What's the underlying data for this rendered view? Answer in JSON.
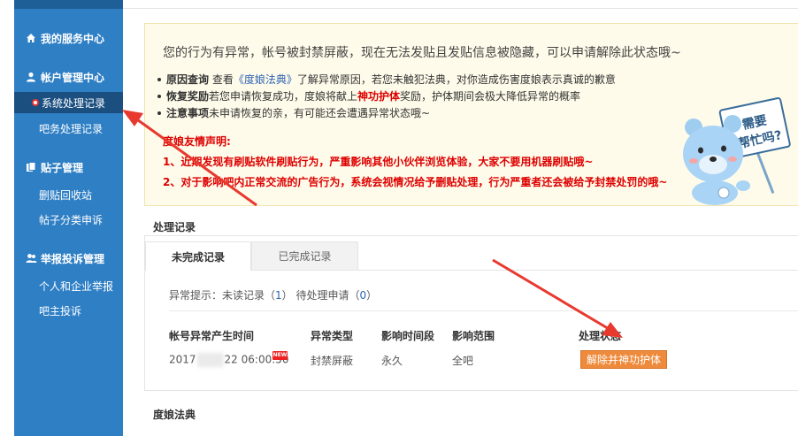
{
  "sidebar": {
    "sections": [
      {
        "label": "我的服务中心",
        "icon": "home-icon",
        "items": []
      },
      {
        "label": "帐户管理中心",
        "icon": "user-icon",
        "items": [
          "系统处理记录",
          "吧务处理记录"
        ]
      },
      {
        "label": "贴子管理",
        "icon": "document-icon",
        "items": [
          "删贴回收站",
          "帖子分类申诉"
        ]
      },
      {
        "label": "举报投诉管理",
        "icon": "users-icon",
        "items": [
          "个人和企业举报",
          "吧主投诉"
        ]
      }
    ]
  },
  "notice": {
    "title": "您的行为有异常，帐号被封禁屏蔽，现在无法发贴且发贴信息被隐藏，可以申请解除此状态哦~",
    "items": [
      {
        "key": "原因查询",
        "pre": " 查看",
        "link": "《度娘法典》",
        "post": "了解异常原因，若您未触犯法典，对你造成伤害度娘表示真诚的歉意"
      },
      {
        "key": "恢复奖励",
        "pre": "若您申请恢复成功，度娘将献上",
        "red": "神功护体",
        "post": "奖励，护体期间会极大降低异常的概率"
      },
      {
        "key": "注意事项",
        "pre": "未申请恢复的亲，有可能还会遭遇异常状态哦~"
      }
    ],
    "declaration_title": "度娘友情声明:",
    "declarations": [
      "1、近期发现有刷贴软件刷贴行为，严重影响其他小伙伴浏览体验，大家不要用机器刷贴哦~",
      "2、对于影响吧内正常交流的广告行为，系统会视情况给予删贴处理，行为严重者还会被给予封禁处罚的哦~"
    ],
    "mascot_sign": "需要\n帮忙吗?"
  },
  "records": {
    "section_title": "处理记录",
    "tabs": [
      "未完成记录",
      "已完成记录"
    ],
    "hint_prefix": "异常提示：未读记录（",
    "unread": "1",
    "hint_mid": "）  待处理申请（",
    "pending": "0",
    "hint_suffix": "）",
    "columns": [
      "帐号异常产生时间",
      "异常类型",
      "影响时间段",
      "影响范围",
      "处理状态"
    ],
    "row": {
      "time_a": "2017",
      "time_b": "22 06:00:50",
      "new_badge": "NEW",
      "type": "封禁屏蔽",
      "duration": "永久",
      "scope": "全吧",
      "action": "解除并神功护体"
    }
  },
  "law_title": "度娘法典",
  "colors": {
    "sidebar": "#2f7fc5",
    "sidebar_active": "#1b4f80",
    "notice_bg": "#fffbea",
    "red_text": "#dd0000",
    "link": "#2d64b3",
    "button": "#ee8a3c",
    "arrow": "#e8392f"
  }
}
